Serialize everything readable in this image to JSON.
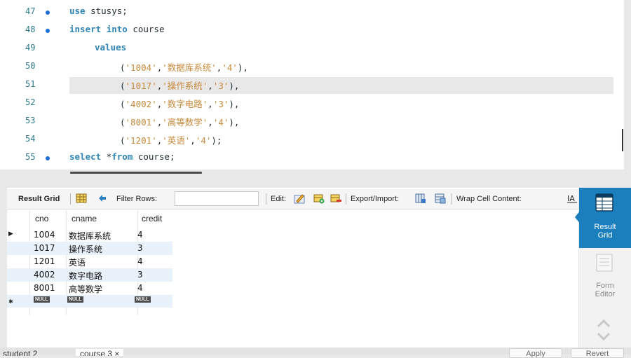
{
  "editor": {
    "lines": [
      {
        "num": "47",
        "dot": true,
        "parts": [
          {
            "t": "use",
            "c": "kw"
          },
          {
            "t": " stusys;",
            "c": "pun"
          }
        ]
      },
      {
        "num": "48",
        "dot": true,
        "parts": [
          {
            "t": "insert",
            "c": "kw"
          },
          {
            "t": " ",
            "c": "pun"
          },
          {
            "t": "into",
            "c": "kw"
          },
          {
            "t": " course",
            "c": "pun"
          }
        ]
      },
      {
        "num": "49",
        "dot": false,
        "parts": [
          {
            "t": "values",
            "c": "kw"
          }
        ]
      },
      {
        "num": "50",
        "dot": false,
        "parts": [
          {
            "t": "(",
            "c": "pun"
          },
          {
            "t": "'1004'",
            "c": "str"
          },
          {
            "t": ",",
            "c": "pun"
          },
          {
            "t": "'数据库系统'",
            "c": "str"
          },
          {
            "t": ",",
            "c": "pun"
          },
          {
            "t": "'4'",
            "c": "str"
          },
          {
            "t": "),",
            "c": "pun"
          }
        ]
      },
      {
        "num": "51",
        "dot": false,
        "parts": [
          {
            "t": "(",
            "c": "pun"
          },
          {
            "t": "'1017'",
            "c": "str"
          },
          {
            "t": ",",
            "c": "pun"
          },
          {
            "t": "'操作系统'",
            "c": "str"
          },
          {
            "t": ",",
            "c": "pun"
          },
          {
            "t": "'3'",
            "c": "str"
          },
          {
            "t": "),",
            "c": "pun"
          }
        ]
      },
      {
        "num": "52",
        "dot": false,
        "parts": [
          {
            "t": "(",
            "c": "pun"
          },
          {
            "t": "'4002'",
            "c": "str"
          },
          {
            "t": ",",
            "c": "pun"
          },
          {
            "t": "'数字电路'",
            "c": "str"
          },
          {
            "t": ",",
            "c": "pun"
          },
          {
            "t": "'3'",
            "c": "str"
          },
          {
            "t": "),",
            "c": "pun"
          }
        ]
      },
      {
        "num": "53",
        "dot": false,
        "parts": [
          {
            "t": "(",
            "c": "pun"
          },
          {
            "t": "'8001'",
            "c": "str"
          },
          {
            "t": ",",
            "c": "pun"
          },
          {
            "t": "'高等数学'",
            "c": "str"
          },
          {
            "t": ",",
            "c": "pun"
          },
          {
            "t": "'4'",
            "c": "str"
          },
          {
            "t": "),",
            "c": "pun"
          }
        ]
      },
      {
        "num": "54",
        "dot": false,
        "parts": [
          {
            "t": "(",
            "c": "pun"
          },
          {
            "t": "'1201'",
            "c": "str"
          },
          {
            "t": ",",
            "c": "pun"
          },
          {
            "t": "'英语'",
            "c": "str"
          },
          {
            "t": ",",
            "c": "pun"
          },
          {
            "t": "'4'",
            "c": "str"
          },
          {
            "t": ");",
            "c": "pun"
          }
        ]
      },
      {
        "num": "55",
        "dot": true,
        "parts": [
          {
            "t": "select",
            "c": "kw"
          },
          {
            "t": " *",
            "c": "pun"
          },
          {
            "t": "from",
            "c": "kw"
          },
          {
            "t": " course;",
            "c": "pun"
          }
        ]
      }
    ]
  },
  "toolbar": {
    "result_grid": "Result Grid",
    "filter_rows": "Filter Rows:",
    "filter_value": "",
    "edit": "Edit:",
    "export_import": "Export/Import:",
    "wrap": "Wrap Cell Content:"
  },
  "grid": {
    "columns": [
      "cno",
      "cname",
      "credit"
    ],
    "rows": [
      [
        "1004",
        "数据库系统",
        "4"
      ],
      [
        "1017",
        "操作系统",
        "3"
      ],
      [
        "1201",
        "英语",
        "4"
      ],
      [
        "4002",
        "数字电路",
        "3"
      ],
      [
        "8001",
        "高等数学",
        "4"
      ]
    ],
    "null_label": "NULL"
  },
  "side": {
    "result_grid": [
      "Result",
      "Grid"
    ],
    "form_editor": [
      "Form",
      "Editor"
    ]
  },
  "tabs": [
    "student 2",
    "course 3"
  ],
  "buttons": [
    "Apply",
    "Revert"
  ],
  "colors": {
    "accent": "#1b7fbd",
    "keyword": "#2f86b6",
    "string": "#c7893a",
    "line_number": "#2f7b8a"
  }
}
